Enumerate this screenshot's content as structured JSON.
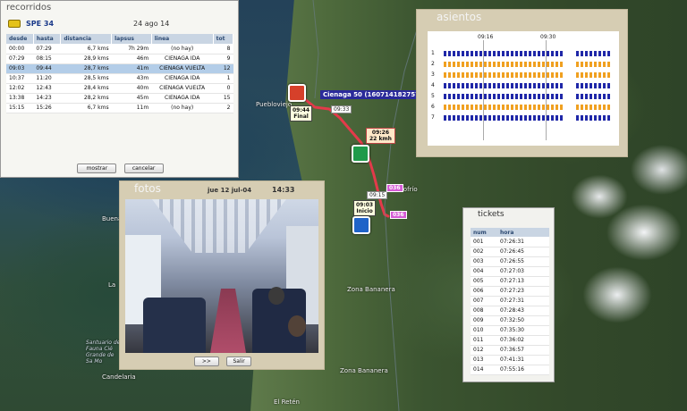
{
  "map": {
    "places": {
      "puebloviejo": "Puebloviejo",
      "rioFrio": "Riofrío",
      "buena": "Buena",
      "la": "La",
      "zonaBananera1": "Zona Bananera",
      "zonaBananera2": "Zona Bananera",
      "candelaria": "Candelaria",
      "elReten": "El Retén",
      "santuario": "Santuario de Fauna Cié Grande de Sa Mo"
    },
    "bus_label": "Cienaga 50 (160714182757)",
    "final_marker": {
      "time": "09:44",
      "label": "Final"
    },
    "start_marker": {
      "time": "09:03",
      "label": "Inicio"
    },
    "speed_box": {
      "time": "09:26",
      "speed": "22 kmh"
    },
    "time_tags": [
      "09:33",
      "09:15"
    ],
    "num_tags": [
      "036",
      "036",
      "036"
    ],
    "colors": {
      "route": "#e33a4a",
      "accent": "#2a2a9a"
    }
  },
  "recorridos": {
    "title": "recorridos",
    "vehicle_id": "SPE 34",
    "date": "24 ago 14",
    "columns": [
      "desde",
      "hasta",
      "distancia",
      "lapsus",
      "linea",
      "tot"
    ],
    "rows": [
      [
        "00:00",
        "07:29",
        "6,7 kms",
        "7h 29m",
        "(no hay)",
        "8"
      ],
      [
        "07:29",
        "08:15",
        "28,9 kms",
        "46m",
        "CIENAGA IDA",
        "9"
      ],
      [
        "09:03",
        "09:44",
        "28,7 kms",
        "41m",
        "CIENAGA VUELTA",
        "12"
      ],
      [
        "10:37",
        "11:20",
        "28,5 kms",
        "43m",
        "CIENAGA IDA",
        "1"
      ],
      [
        "12:02",
        "12:43",
        "28,4 kms",
        "40m",
        "CIENAGA VUELTA",
        "0"
      ],
      [
        "13:38",
        "14:23",
        "28,2 kms",
        "45m",
        "CIENAGA IDA",
        "15"
      ],
      [
        "15:15",
        "15:26",
        "6,7 kms",
        "11m",
        "(no hay)",
        "2"
      ]
    ],
    "selected_row": 2,
    "buttons": {
      "show": "mostrar",
      "cancel": "cancelar"
    }
  },
  "asientos": {
    "title": "asientos",
    "time_labels": [
      "09:16",
      "09:30"
    ],
    "seat_numbers": [
      "1",
      "2",
      "3",
      "4",
      "5",
      "6",
      "7"
    ],
    "colors": {
      "occupied": "#1f27a8",
      "other": "#f0a020"
    },
    "seat_colors": [
      "blue",
      "orange",
      "orange",
      "blue",
      "blue",
      "orange",
      "blue"
    ]
  },
  "fotos": {
    "title": "fotos",
    "date": "jue 12 jul-04",
    "time": "14:33",
    "buttons": {
      "next": ">>",
      "exit": "Salir"
    }
  },
  "tickets": {
    "title": "tickets",
    "columns": [
      "num",
      "hora"
    ],
    "rows": [
      [
        "001",
        "07:26:31"
      ],
      [
        "002",
        "07:26:45"
      ],
      [
        "003",
        "07:26:55"
      ],
      [
        "004",
        "07:27:03"
      ],
      [
        "005",
        "07:27:13"
      ],
      [
        "006",
        "07:27:23"
      ],
      [
        "007",
        "07:27:31"
      ],
      [
        "008",
        "07:28:43"
      ],
      [
        "009",
        "07:32:50"
      ],
      [
        "010",
        "07:35:30"
      ],
      [
        "011",
        "07:36:02"
      ],
      [
        "012",
        "07:36:57"
      ],
      [
        "013",
        "07:41:31"
      ],
      [
        "014",
        "07:55:16"
      ]
    ]
  }
}
